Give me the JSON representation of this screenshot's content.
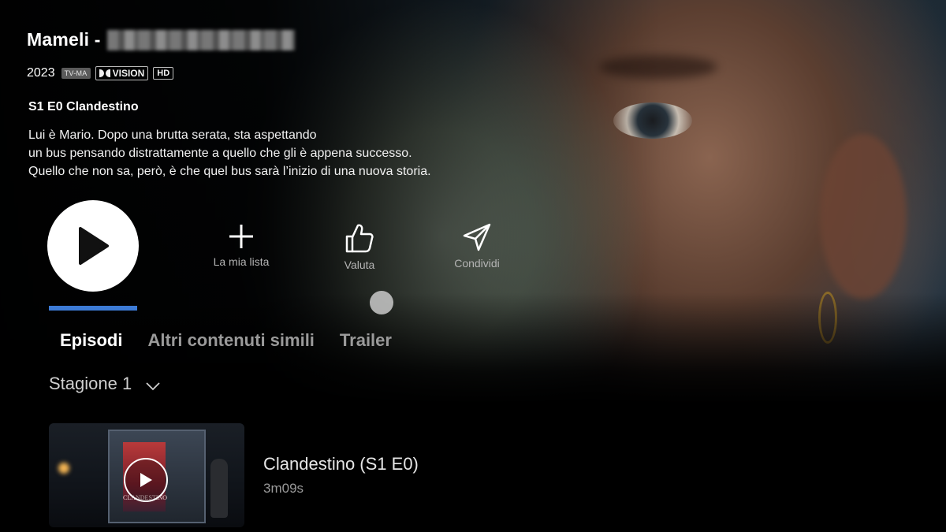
{
  "show": {
    "title": "Mameli -",
    "year": "2023",
    "rating_badge": "TV-MA",
    "vision_badge": "VISION",
    "hd_badge": "HD"
  },
  "episode": {
    "heading": "S1 E0 Clandestino",
    "synopsis_lines": [
      "Lui è Mario. Dopo una brutta serata, sta aspettando",
      "un bus pensando distrattamente a quello che gli è appena successo.",
      "Quello che non sa, però, è che quel bus sarà l’inizio di una nuova storia."
    ]
  },
  "actions": {
    "my_list": "La mia lista",
    "rate": "Valuta",
    "share": "Condividi"
  },
  "tabs": [
    {
      "label": "Episodi",
      "active": true
    },
    {
      "label": "Altri contenuti simili",
      "active": false
    },
    {
      "label": "Trailer",
      "active": false
    }
  ],
  "season": {
    "label": "Stagione 1"
  },
  "episodes": [
    {
      "title": "Clandestino (S1 E0)",
      "duration": "3m09s",
      "thumb_poster_text": "CLANDESTINO"
    }
  ],
  "colors": {
    "focus_accent": "#3d7bd6",
    "background": "#000000"
  },
  "icons": {
    "play": "play-icon",
    "add": "plus-icon",
    "rate": "thumbs-up-icon",
    "share": "send-icon",
    "season_dropdown": "chevron-down-icon"
  }
}
